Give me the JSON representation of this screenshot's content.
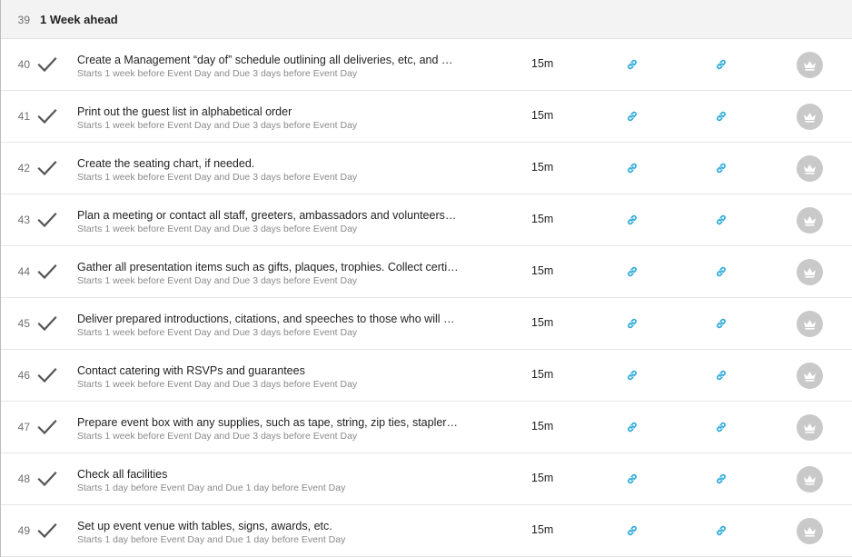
{
  "section": {
    "number": "39",
    "title": "1 Week ahead"
  },
  "rows": [
    {
      "number": "40",
      "title": "Create a Management “day of” schedule outlining all deliveries, etc, and when they are expected",
      "subtitle": "Starts 1 week before Event Day and Due 3 days before Event Day",
      "duration": "15m"
    },
    {
      "number": "41",
      "title": "Print out the guest list in alphabetical order",
      "subtitle": "Starts 1 week before Event Day and Due 3 days before Event Day",
      "duration": "15m"
    },
    {
      "number": "42",
      "title": "Create the seating chart, if needed.",
      "subtitle": "Starts 1 week before Event Day and Due 3 days before Event Day",
      "duration": "15m"
    },
    {
      "number": "43",
      "title": "Plan a meeting or contact all staff, greeters, ambassadors and volunteers to review duties",
      "subtitle": "Starts 1 week before Event Day and Due 3 days before Event Day",
      "duration": "15m"
    },
    {
      "number": "44",
      "title": "Gather all presentation items such as gifts, plaques, trophies. Collect certificates",
      "subtitle": "Starts 1 week before Event Day and Due 3 days before Event Day",
      "duration": "15m"
    },
    {
      "number": "45",
      "title": "Deliver prepared introductions, citations, and speeches to those who will present them",
      "subtitle": "Starts 1 week before Event Day and Due 3 days before Event Day",
      "duration": "15m"
    },
    {
      "number": "46",
      "title": "Contact catering with RSVPs and guarantees",
      "subtitle": "Starts 1 week before Event Day and Due 3 days before Event Day",
      "duration": "15m"
    },
    {
      "number": "47",
      "title": "Prepare event box with any supplies, such as tape, string, zip ties, staplers, scissors",
      "subtitle": "Starts 1 week before Event Day and Due 3 days before Event Day",
      "duration": "15m"
    },
    {
      "number": "48",
      "title": "Check all facilities",
      "subtitle": "Starts 1 day before Event Day and Due 1 day before Event Day",
      "duration": "15m"
    },
    {
      "number": "49",
      "title": "Set up event venue with tables, signs, awards, etc.",
      "subtitle": "Starts 1 day before Event Day and Due 1 day before Event Day",
      "duration": "15m"
    }
  ],
  "icons": {
    "check": "check-icon",
    "link": "link-icon",
    "crown": "crown-icon"
  },
  "colors": {
    "link": "#29a8d8",
    "check": "#555555",
    "crown_bg": "#c9c9c9",
    "section_bg": "#f3f3f3"
  }
}
